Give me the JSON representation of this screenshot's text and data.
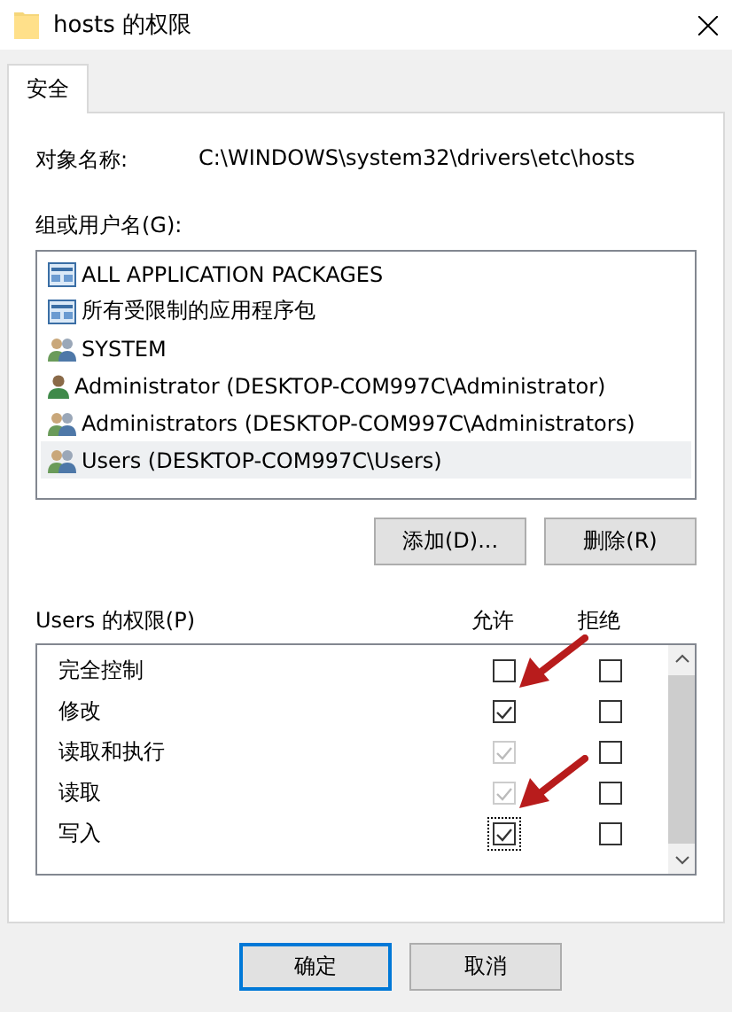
{
  "window": {
    "title": "hosts 的权限"
  },
  "tabs": [
    {
      "label": "安全",
      "selected": true
    }
  ],
  "object_name": {
    "label": "对象名称:",
    "value": "C:\\WINDOWS\\system32\\drivers\\etc\\hosts"
  },
  "groups": {
    "label": "组或用户名(G):",
    "items": [
      {
        "name": "ALL APPLICATION PACKAGES",
        "kind": "package",
        "selected": false
      },
      {
        "name": "所有受限制的应用程序包",
        "kind": "package",
        "selected": false
      },
      {
        "name": "SYSTEM",
        "kind": "group",
        "selected": false
      },
      {
        "name": "Administrator (DESKTOP-COM997C\\Administrator)",
        "kind": "user",
        "selected": false
      },
      {
        "name": "Administrators (DESKTOP-COM997C\\Administrators)",
        "kind": "group",
        "selected": false
      },
      {
        "name": "Users (DESKTOP-COM997C\\Users)",
        "kind": "group",
        "selected": true
      }
    ]
  },
  "group_buttons": [
    "添加(D)...",
    "删除(R)"
  ],
  "permissions": {
    "label": "Users 的权限(P)",
    "allow_header": "允许",
    "deny_header": "拒绝",
    "rows": [
      {
        "name": "完全控制",
        "allow": {
          "checked": false,
          "disabled": false
        },
        "deny": {
          "checked": false,
          "disabled": false
        }
      },
      {
        "name": "修改",
        "allow": {
          "checked": true,
          "disabled": false
        },
        "deny": {
          "checked": false,
          "disabled": false
        }
      },
      {
        "name": "读取和执行",
        "allow": {
          "checked": true,
          "disabled": true
        },
        "deny": {
          "checked": false,
          "disabled": false
        }
      },
      {
        "name": "读取",
        "allow": {
          "checked": true,
          "disabled": true
        },
        "deny": {
          "checked": false,
          "disabled": false
        }
      },
      {
        "name": "写入",
        "allow": {
          "checked": true,
          "disabled": false
        },
        "deny": {
          "checked": false,
          "disabled": false
        }
      }
    ]
  },
  "dialog_buttons": [
    "确定",
    "取消"
  ]
}
